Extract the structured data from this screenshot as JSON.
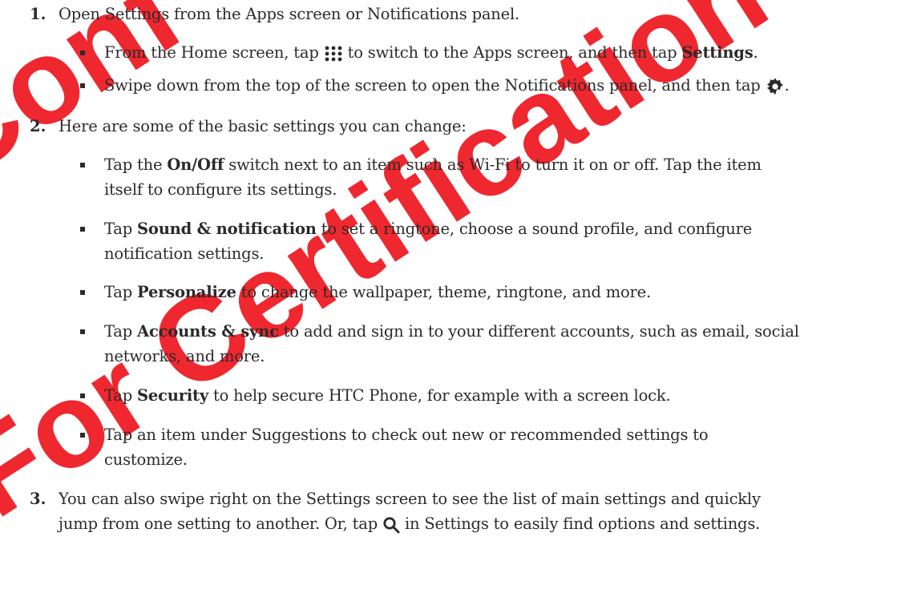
{
  "watermark": {
    "line1": "Conf",
    "line2": "For Certification"
  },
  "steps": [
    {
      "number": "1.",
      "text": "Open Settings from the Apps screen or Notifications panel.",
      "bullets": [
        {
          "pre": "From the Home screen, tap",
          "mid": "to switch to the Apps screen, and then tap",
          "bold": "Settings",
          "post": "."
        },
        {
          "pre": "Swipe down from the top of the screen to open the Notifications panel, and then tap",
          "post": "."
        }
      ]
    },
    {
      "number": "2.",
      "text": "Here are some of the basic settings you can change:",
      "bullets": [
        {
          "pre": "Tap the",
          "bold": "On/Off",
          "line1_post": "switch next to an item such as Wi-Fi to turn it on or off. Tap the item",
          "line2": "itself to configure its settings."
        },
        {
          "pre": "Tap",
          "bold": "Sound & notification",
          "line1_post": "to set a ringtone, choose a sound profile, and configure",
          "line2": "notification settings."
        },
        {
          "pre": "Tap",
          "bold": "Personalize",
          "line1_post": "to change the wallpaper, theme, ringtone, and more."
        },
        {
          "pre": "Tap",
          "bold": "Accounts & sync",
          "line1_post": "to add and sign in to your different accounts, such as email, social",
          "line2": "networks, and more."
        },
        {
          "pre": "Tap",
          "bold": "Security",
          "line1_post": "to help secure HTC Phone, for example with a screen lock."
        },
        {
          "line1": "Tap an item under Suggestions to check out new or recommended settings to",
          "line2": "customize."
        }
      ]
    },
    {
      "number": "3.",
      "line1": "You can also swipe right on the Settings screen to see the list of main settings and quickly",
      "line2_pre": "jump from one setting to another. Or, tap",
      "line2_post": "in Settings to easily find options and settings."
    }
  ],
  "icons": {
    "apps": "apps-grid-icon",
    "settings": "gear-icon",
    "search": "search-icon"
  },
  "colors": {
    "text": "#2b2b2b",
    "watermark": "#e8101b"
  }
}
